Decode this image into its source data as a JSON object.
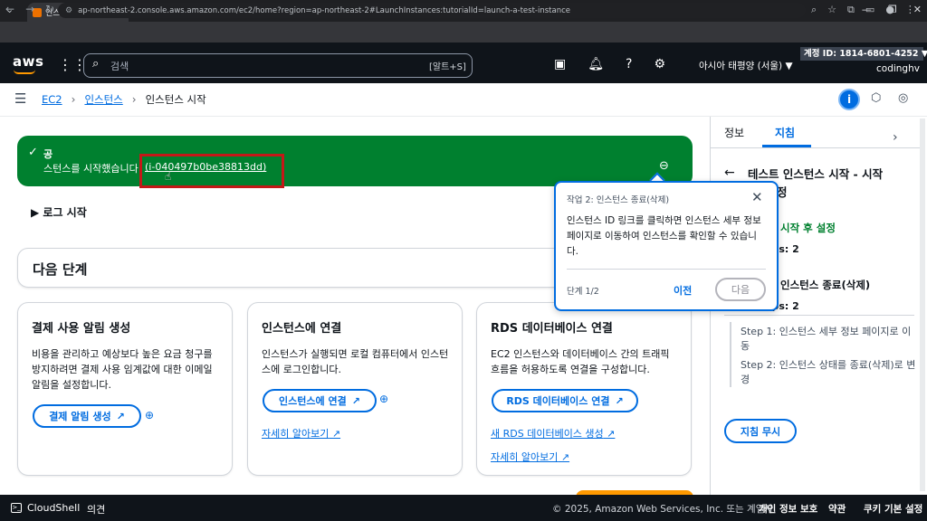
{
  "browser": {
    "tab_title": "인스턴스 시작 | EC2 | ap-north",
    "tab_close": "×",
    "new_tab": "+",
    "url": "ap-northeast-2.console.aws.amazon.com/ec2/home?region=ap-northeast-2#LaunchInstances:tutorialId=launch-a-test-instance",
    "window_controls": [
      "—",
      "❐",
      "✕"
    ]
  },
  "aws_header": {
    "logo": "aws",
    "search_placeholder": "검색",
    "search_shortcut": "[알트+S]",
    "region": "아시아 태평양 (서울) ▼",
    "account": "계정 ID: 1814-6801-4252 ▼",
    "username": "codinghv"
  },
  "breadcrumb": {
    "items": [
      "EC2",
      "인스턴스",
      "인스턴스 시작"
    ],
    "sep": "›",
    "info_icon": "i"
  },
  "flash": {
    "title": "공",
    "message": "스턴스를 시작했습니다",
    "instance_link": "(i-040497b0be38813dd)"
  },
  "log_section": "▶ 로그 시작",
  "next_steps": {
    "title": "다음 단계",
    "cards": [
      {
        "title": "결제 사용 알림 생성",
        "body": "비용을 관리하고 예상보다 높은 요금 청구를 방지하려면 결제 사용 임계값에 대한 이메일 알림을 설정합니다.",
        "button": "결제 알림 생성"
      },
      {
        "title": "인스턴스에 연결",
        "body": "인스턴스가 실행되면 로컬 컴퓨터에서 인스턴스에 로그인합니다.",
        "button": "인스턴스에 연결",
        "link": "자세히 알아보기"
      },
      {
        "title": "RDS 데이터베이스 연결",
        "body": "EC2 인스턴스와 데이터베이스 간의 트래픽 흐름을 허용하도록 연결을 구성합니다.",
        "button": "RDS 데이터베이스 연결",
        "link1": "새 RDS 데이터베이스 생성",
        "link2": "자세히 알아보기"
      }
    ]
  },
  "popover": {
    "header": "작업 2: 인스턴스 종료(삭제)",
    "body": "인스턴스 ID 링크를 클릭하면 인스턴스 세부 정보 페이지로 이동하여 인스턴스를 확인할 수 있습니다.",
    "step": "단계 1/2",
    "prev": "이전",
    "next": "다음"
  },
  "panel": {
    "tab_info": "정보",
    "tab_guide": "지침",
    "title_line1": "테스트 인스턴스 시작 - 시작",
    "title_line2": "정",
    "section1": "시작 후 설정",
    "section1_steps": "eps: 2",
    "section2": "인스턴스 종료(삭제)",
    "section2_steps": "eps: 2",
    "step1": "Step 1: 인스턴스 세부 정보 페이지로 이동",
    "step2": "Step 2: 인스턴스 상태를 종료(삭제)로 변경",
    "dismiss": "지침 무시"
  },
  "footer": {
    "cloudshell": "CloudShell",
    "feedback": "의견",
    "copyright": "© 2025, Amazon Web Services, Inc. 또는 계열사.",
    "privacy": "개인 정보 보호",
    "terms": "약관",
    "cookie": "쿠키 기본 설정"
  }
}
